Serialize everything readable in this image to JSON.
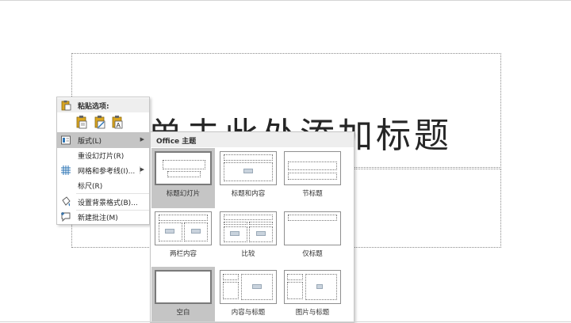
{
  "slide": {
    "title_text": "单击此处添加标题"
  },
  "context_menu": {
    "paste_header": "粘贴选项:",
    "paste_icons": [
      "paste-keep-source-icon",
      "paste-picture-icon",
      "paste-text-only-icon"
    ],
    "items": [
      {
        "label": "版式(L)",
        "icon": "layout-icon",
        "submenu": true,
        "highlighted": true
      },
      {
        "label": "重设幻灯片(R)",
        "icon": "",
        "submenu": false
      },
      {
        "label": "网格和参考线(I)...",
        "icon": "grid-icon",
        "submenu": true
      },
      {
        "label": "标尺(R)",
        "icon": "",
        "submenu": false
      },
      {
        "label": "设置背景格式(B)...",
        "icon": "format-background-icon",
        "submenu": false
      },
      {
        "label": "新建批注(M)",
        "icon": "new-comment-icon",
        "submenu": false
      }
    ]
  },
  "layout_menu": {
    "header": "Office 主题",
    "layouts": [
      {
        "label": "标题幻灯片",
        "selected": true
      },
      {
        "label": "标题和内容",
        "selected": false
      },
      {
        "label": "节标题",
        "selected": false
      },
      {
        "label": "两栏内容",
        "selected": false
      },
      {
        "label": "比较",
        "selected": false
      },
      {
        "label": "仅标题",
        "selected": false
      },
      {
        "label": "空白",
        "selected": true
      },
      {
        "label": "内容与标题",
        "selected": false
      },
      {
        "label": "图片与标题",
        "selected": false
      }
    ]
  },
  "colors": {
    "highlight": "#c5c5c5",
    "menu_header": "#eeeeee",
    "icon_blue": "#2e75b6",
    "icon_gold": "#d9a520"
  }
}
